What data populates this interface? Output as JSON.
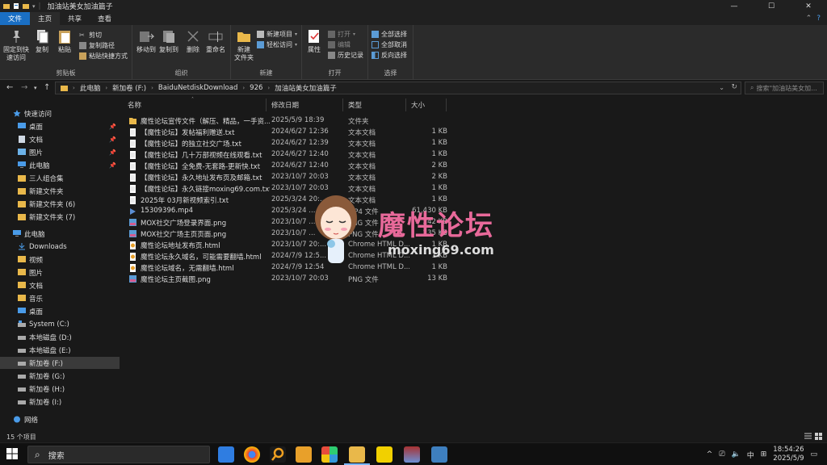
{
  "window": {
    "title": "加油站美女加油篇子",
    "minimize": "—",
    "maximize": "☐",
    "close": "✕"
  },
  "tabs": [
    {
      "label": "文件"
    },
    {
      "label": "主页"
    },
    {
      "label": "共享"
    },
    {
      "label": "查看"
    }
  ],
  "ribbon": {
    "clipboard": {
      "label": "剪贴板",
      "pin": "固定到快速访问",
      "copy": "复制",
      "paste": "粘贴",
      "cut": "剪切",
      "copy_path": "复制路径",
      "paste_shortcut": "粘贴快捷方式"
    },
    "organize": {
      "label": "组织",
      "move_to": "移动到",
      "copy_to": "复制到",
      "delete": "删除",
      "rename": "重命名"
    },
    "new": {
      "label": "新建",
      "new_folder": "新建\n文件夹",
      "new_item": "新建项目",
      "easy_access": "轻松访问"
    },
    "open": {
      "label": "打开",
      "properties": "属性",
      "open": "打开",
      "edit": "编辑",
      "history": "历史记录"
    },
    "select": {
      "label": "选择",
      "select_all": "全部选择",
      "select_none": "全部取消",
      "invert": "反向选择"
    }
  },
  "address": {
    "crumbs": [
      "此电脑",
      "新加卷 (F:)",
      "BaiduNetdiskDownload",
      "926",
      "加油站美女加油篇子"
    ],
    "search_placeholder": "搜索\"加油站美女加..."
  },
  "nav": {
    "items": [
      {
        "label": "快速访问",
        "icon": "star-icon",
        "pinned": false
      },
      {
        "label": "桌面",
        "icon": "desktop-icon",
        "pinned": true
      },
      {
        "label": "文档",
        "icon": "document-icon",
        "pinned": true
      },
      {
        "label": "图片",
        "icon": "pictures-icon",
        "pinned": true
      },
      {
        "label": "此电脑",
        "icon": "pc-icon",
        "pinned": true
      },
      {
        "label": "三人组合集",
        "icon": "folder-icon",
        "pinned": false
      },
      {
        "label": "新建文件夹",
        "icon": "folder-icon",
        "pinned": false
      },
      {
        "label": "新建文件夹 (6)",
        "icon": "folder-icon",
        "pinned": false
      },
      {
        "label": "新建文件夹 (7)",
        "icon": "folder-icon",
        "pinned": false
      },
      {
        "label": "此电脑",
        "icon": "pc-icon",
        "pinned": false
      },
      {
        "label": "Downloads",
        "icon": "download-icon",
        "pinned": false
      },
      {
        "label": "视频",
        "icon": "video-icon",
        "pinned": false
      },
      {
        "label": "图片",
        "icon": "pictures-icon",
        "pinned": false
      },
      {
        "label": "文档",
        "icon": "document-icon",
        "pinned": false
      },
      {
        "label": "音乐",
        "icon": "music-icon",
        "pinned": false
      },
      {
        "label": "桌面",
        "icon": "desktop-icon",
        "pinned": false
      },
      {
        "label": "System (C:)",
        "icon": "drive-icon",
        "pinned": false
      },
      {
        "label": "本地磁盘 (D:)",
        "icon": "drive-icon",
        "pinned": false
      },
      {
        "label": "本地磁盘 (E:)",
        "icon": "drive-icon",
        "pinned": false
      },
      {
        "label": "新加卷 (F:)",
        "icon": "drive-icon",
        "pinned": false,
        "selected": true
      },
      {
        "label": "新加卷 (G:)",
        "icon": "drive-icon",
        "pinned": false
      },
      {
        "label": "新加卷 (H:)",
        "icon": "drive-icon",
        "pinned": false
      },
      {
        "label": "新加卷 (I:)",
        "icon": "drive-icon",
        "pinned": false
      },
      {
        "label": "网络",
        "icon": "network-icon",
        "pinned": false
      }
    ]
  },
  "columns": {
    "name": "名称",
    "date": "修改日期",
    "type": "类型",
    "size": "大小"
  },
  "files": [
    {
      "name": "魔性论坛宣传文件（解压、精品，一手资...",
      "date": "2025/5/9 18:39",
      "type": "文件夹",
      "size": "",
      "icon": "folder-icon"
    },
    {
      "name": "【魔性论坛】发帖福利赠送.txt",
      "date": "2024/6/27 12:36",
      "type": "文本文档",
      "size": "1 KB",
      "icon": "text-file-icon"
    },
    {
      "name": "【魔性论坛】的独立社交广场.txt",
      "date": "2024/6/27 12:39",
      "type": "文本文档",
      "size": "1 KB",
      "icon": "text-file-icon"
    },
    {
      "name": "【魔性论坛】几十万部视频在线观看.txt",
      "date": "2024/6/27 12:40",
      "type": "文本文档",
      "size": "1 KB",
      "icon": "text-file-icon"
    },
    {
      "name": "【魔性论坛】全免费-无套路-更新快.txt",
      "date": "2024/6/27 12:40",
      "type": "文本文档",
      "size": "2 KB",
      "icon": "text-file-icon"
    },
    {
      "name": "【魔性论坛】永久地址发布页及邮箱.txt",
      "date": "2023/10/7 20:03",
      "type": "文本文档",
      "size": "2 KB",
      "icon": "text-file-icon"
    },
    {
      "name": "【魔性论坛】永久链接moxing69.com.txt",
      "date": "2023/10/7 20:03",
      "type": "文本文档",
      "size": "1 KB",
      "icon": "text-file-icon"
    },
    {
      "name": "2025年 03月新视频索引.txt",
      "date": "2025/3/24 20:...",
      "type": "文本文档",
      "size": "1 KB",
      "icon": "text-file-icon"
    },
    {
      "name": "15309396.mp4",
      "date": "2025/3/24 ...",
      "type": "MP4 文件",
      "size": "61,430 KB",
      "icon": "video-file-icon"
    },
    {
      "name": "MOX社交广场登录界面.png",
      "date": "2023/10/7 ...",
      "type": "PNG 文件",
      "size": "242 KB",
      "icon": "image-file-icon"
    },
    {
      "name": "MOX社交广场主页页面.png",
      "date": "2023/10/7 ...",
      "type": "PNG 文件",
      "size": "235 KB",
      "icon": "image-file-icon"
    },
    {
      "name": "魔性论坛地址发布页.html",
      "date": "2023/10/7 20:...",
      "type": "Chrome HTML D...",
      "size": "1 KB",
      "icon": "html-file-icon"
    },
    {
      "name": "魔性论坛永久域名，可能需要翻墙.html",
      "date": "2024/7/9 12:5...",
      "type": "Chrome HTML D...",
      "size": "1 KB",
      "icon": "html-file-icon"
    },
    {
      "name": "魔性论坛域名，无需翻墙.html",
      "date": "2024/7/9 12:54",
      "type": "Chrome HTML D...",
      "size": "1 KB",
      "icon": "html-file-icon"
    },
    {
      "name": "魔性论坛主页截图.png",
      "date": "2023/10/7 20:03",
      "type": "PNG 文件",
      "size": "13 KB",
      "icon": "image-file-icon"
    }
  ],
  "watermark": {
    "text": "魔性论坛",
    "url": "moxing69.com"
  },
  "status": {
    "count": "15 个项目"
  },
  "taskbar": {
    "search": "搜索",
    "tray_lang": "中",
    "time": "18:54:26",
    "date": "2025/5/9"
  },
  "colors": {
    "accent": "#1a6fc4",
    "folder": "#e9b84a",
    "watermark": "#e8699a"
  }
}
